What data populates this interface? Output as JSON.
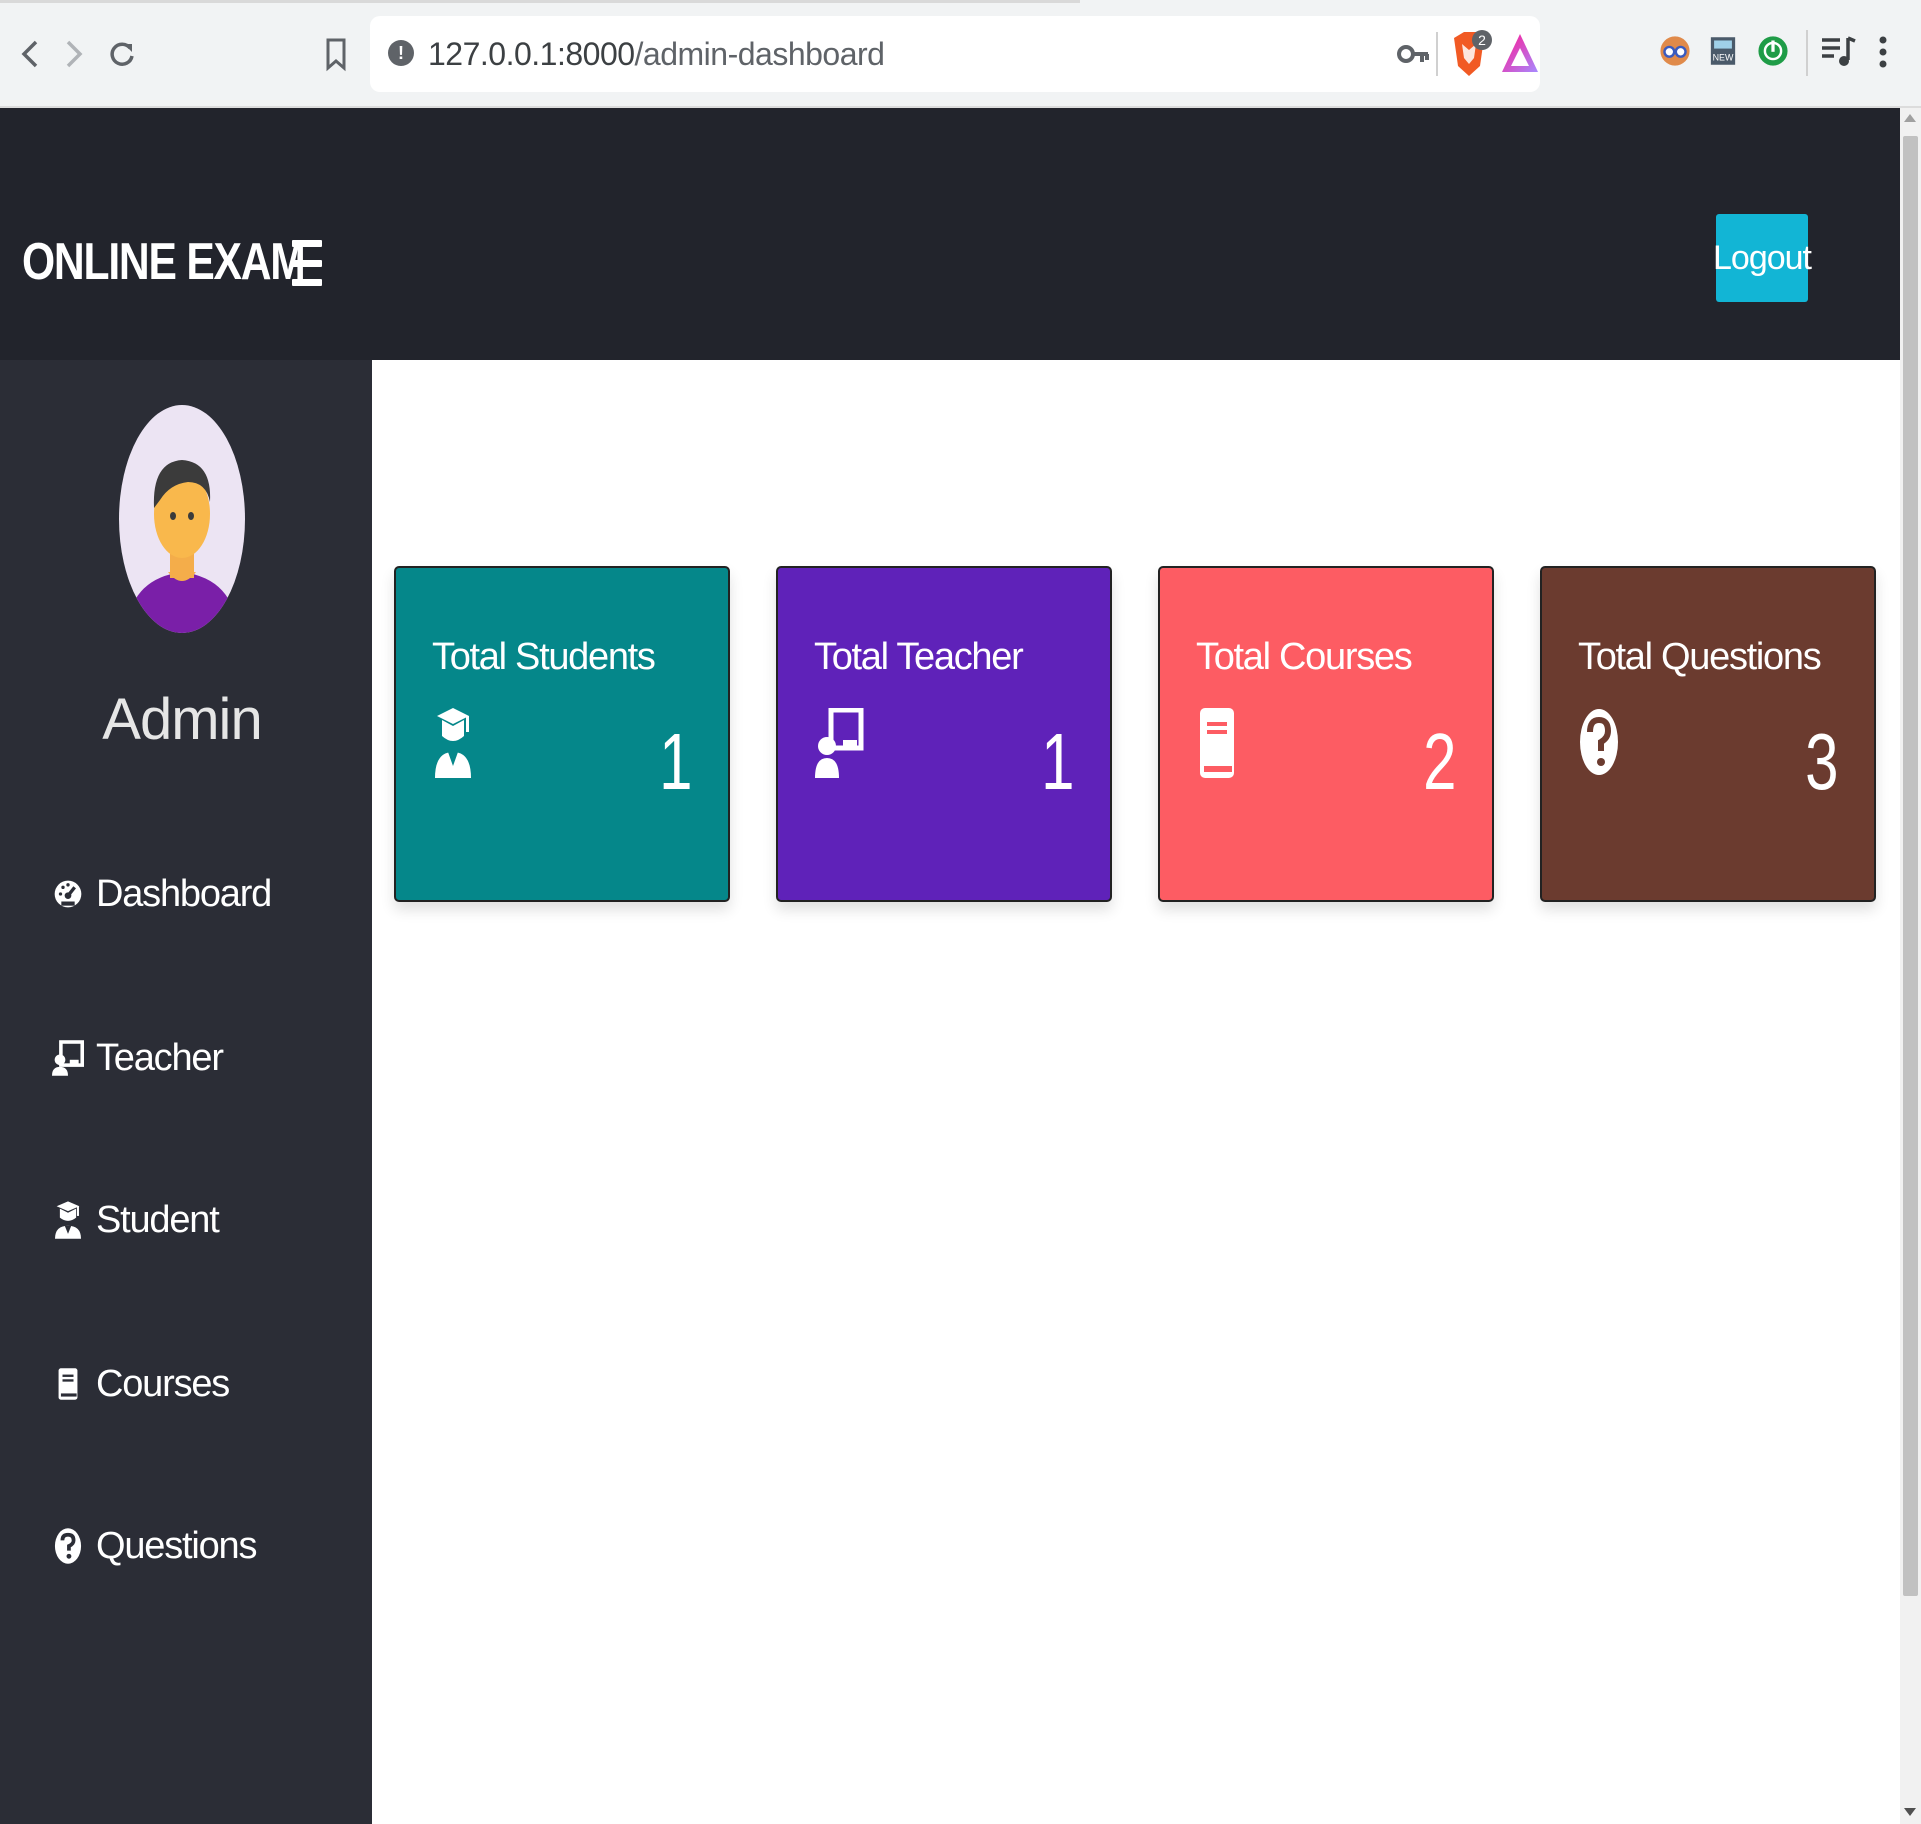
{
  "browser": {
    "url_host": "127.0.0.1:8000",
    "url_path": "/admin-dashboard",
    "brave_badge": "2"
  },
  "header": {
    "brand": "ONLINE EXAM",
    "logout_label": "Logout",
    "bg_color": "#22242c",
    "logout_color": "#12b5d5"
  },
  "sidebar": {
    "admin_name": "Admin",
    "items": [
      {
        "label": "Dashboard",
        "icon": "tachometer-icon"
      },
      {
        "label": "Teacher",
        "icon": "chalkboard-teacher-icon"
      },
      {
        "label": "Student",
        "icon": "user-graduate-icon"
      },
      {
        "label": "Courses",
        "icon": "book-icon"
      },
      {
        "label": "Questions",
        "icon": "question-circle-icon"
      }
    ],
    "bg_color": "#2b2d36"
  },
  "cards": [
    {
      "title": "Total Students",
      "value": "1",
      "icon": "user-graduate-icon",
      "color": "#05878a"
    },
    {
      "title": "Total Teacher",
      "value": "1",
      "icon": "chalkboard-teacher-icon",
      "color": "#5f22b9"
    },
    {
      "title": "Total Courses",
      "value": "2",
      "icon": "book-icon",
      "color": "#fd5c63"
    },
    {
      "title": "Total Questions",
      "value": "3",
      "icon": "question-circle-icon",
      "color": "#6b3b2f"
    }
  ]
}
